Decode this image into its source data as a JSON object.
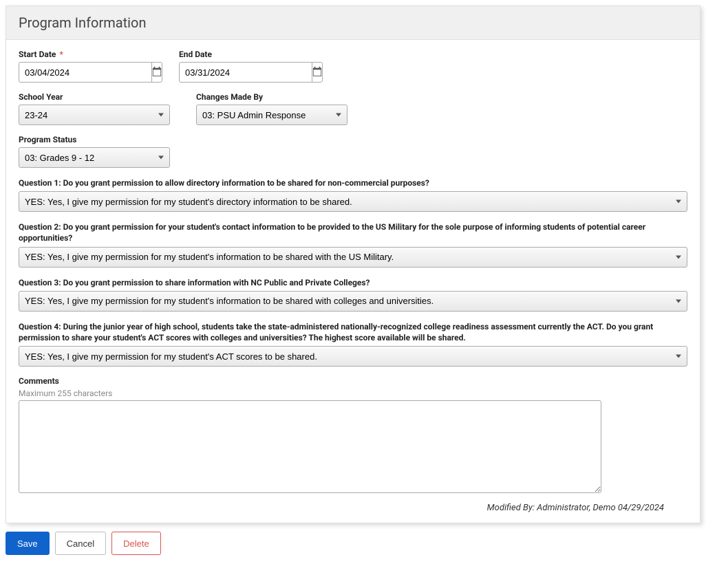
{
  "header": {
    "title": "Program Information"
  },
  "fields": {
    "start_date": {
      "label": "Start Date",
      "required_star": "*",
      "value": "03/04/2024"
    },
    "end_date": {
      "label": "End Date",
      "value": "03/31/2024"
    },
    "school_year": {
      "label": "School Year",
      "value": "23-24"
    },
    "changes_made_by": {
      "label": "Changes Made By",
      "value": "03: PSU Admin Response"
    },
    "program_status": {
      "label": "Program Status",
      "value": "03: Grades 9 - 12"
    }
  },
  "questions": {
    "q1": {
      "label": "Question 1: Do you grant permission to allow directory information to be shared for non-commercial purposes?",
      "value": "YES: Yes, I give my permission for my student's directory information to be shared."
    },
    "q2": {
      "label": "Question 2: Do you grant permission for your student's contact information to be provided to the US Military for the sole purpose of informing students of potential career opportunities?",
      "value": "YES: Yes, I give my permission for my student's information to be shared with the US Military."
    },
    "q3": {
      "label": "Question 3: Do you grant permission to share information with NC Public and Private Colleges?",
      "value": "YES: Yes, I give my permission for my student's information to be shared with colleges and universities."
    },
    "q4": {
      "label": "Question 4: During the junior year of high school, students take the state-administered nationally-recognized college readiness assessment currently the ACT. Do you grant permission to share your student's ACT scores with colleges and universities? The highest score available will be shared.",
      "value": "YES: Yes, I give my permission for my student's ACT scores to be shared."
    },
    "comments": {
      "label": "Comments",
      "hint": "Maximum 255 characters",
      "value": ""
    }
  },
  "footer": {
    "modified_by": "Modified By: Administrator, Demo 04/29/2024"
  },
  "actions": {
    "save": "Save",
    "cancel": "Cancel",
    "delete": "Delete"
  }
}
